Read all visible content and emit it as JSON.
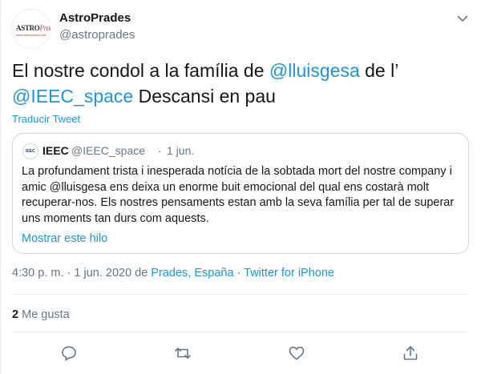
{
  "author": {
    "name": "AstroPrades",
    "handle": "@astroprades",
    "avatar_text_main": "ASTRO",
    "avatar_text_accent": "Prades",
    "avatar_subtext": "www.astroprades.cat"
  },
  "tweet": {
    "text_before": "El nostre condol a la família de ",
    "mention1": "@lluisgesa",
    "text_middle": " de l’ ",
    "mention2": "@IEEC_space",
    "text_after": " Descansi en pau",
    "translate_label": "Traducir Tweet"
  },
  "quote": {
    "avatar_text": "IEEC",
    "name": "IEEC",
    "handle": "@IEEC_space",
    "separator": "·",
    "date": "1 jun.",
    "text": "La profundament trista i inesperada notícia de la sobtada mort del nostre company i amic @lluisgesa ens deixa un enorme buit emocional del qual ens costarà molt recuperar-nos. Els nostres pensaments estan amb la seva família per tal de superar uns moments tan durs com aquests.",
    "show_thread": "Mostrar este hilo"
  },
  "meta": {
    "time": "4:30 p. m.",
    "sep1": " · ",
    "date": "1 jun. 2020",
    "de": " de ",
    "location": "Prades, España",
    "sep2": " · ",
    "source": "Twitter for iPhone"
  },
  "stats": {
    "likes_count": "2",
    "likes_label": " Me gusta"
  },
  "icons": {
    "chevron": "chevron-down-icon",
    "reply": "reply-icon",
    "retweet": "retweet-icon",
    "like": "like-icon",
    "share": "share-icon"
  },
  "colors": {
    "link": "#1b95e0",
    "secondary": "#657786",
    "border": "#ccd6dd"
  }
}
